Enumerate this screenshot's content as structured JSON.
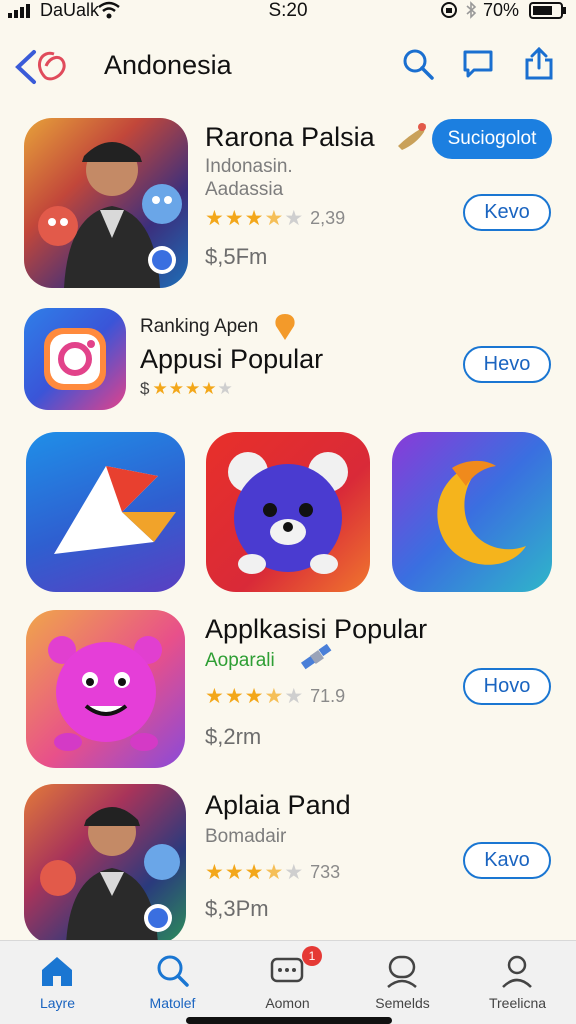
{
  "status_bar": {
    "carrier": "DaUalk",
    "time": "S:20",
    "battery": "70%",
    "icons": [
      "signal-icon",
      "wifi-icon",
      "rotation-lock-icon",
      "bluetooth-icon",
      "battery-icon"
    ]
  },
  "header": {
    "title": "Andonesia",
    "icons": [
      "back-icon",
      "search-icon",
      "chat-icon",
      "share-icon"
    ]
  },
  "apps": [
    {
      "name": "Rarona Palsia",
      "subtitle": "Indonasin.",
      "developer": "Aadassia",
      "rating": 3.5,
      "rating_count": "2,39",
      "price": "$,5Fm",
      "badge": "Suciogolot",
      "action": "Kevo"
    },
    {
      "overline": "Ranking Apen",
      "name": "Appusi Popular",
      "price_prefix": "$",
      "rating": 4,
      "action": "Hevo"
    },
    {
      "name": "Applkasisi Popular",
      "subtitle": "Aoparali",
      "rating": 3.5,
      "rating_count": "71.9",
      "price": "$,2rm",
      "action": "Hovo"
    },
    {
      "name": "Aplaia Pand",
      "subtitle": "Bomadair",
      "rating": 3.5,
      "rating_count": "733",
      "price": "$,3Pm",
      "action": "Kavo"
    }
  ],
  "featured_icons": [
    "arrow-app-icon",
    "bear-app-icon",
    "moon-app-icon"
  ],
  "tab_bar": {
    "tabs": [
      {
        "label": "Layre",
        "icon": "home-icon",
        "active": true
      },
      {
        "label": "Matolef",
        "icon": "search-icon",
        "active": true
      },
      {
        "label": "Aomon",
        "icon": "messages-icon",
        "badge": "1"
      },
      {
        "label": "Semelds",
        "icon": "person-icon"
      },
      {
        "label": "Treelicna",
        "icon": "profile-icon"
      }
    ]
  },
  "colors": {
    "accent": "#1c7fe0",
    "star": "#f3a71a",
    "background": "#fbf8ee",
    "green_subtitle": "#2e9e34"
  }
}
